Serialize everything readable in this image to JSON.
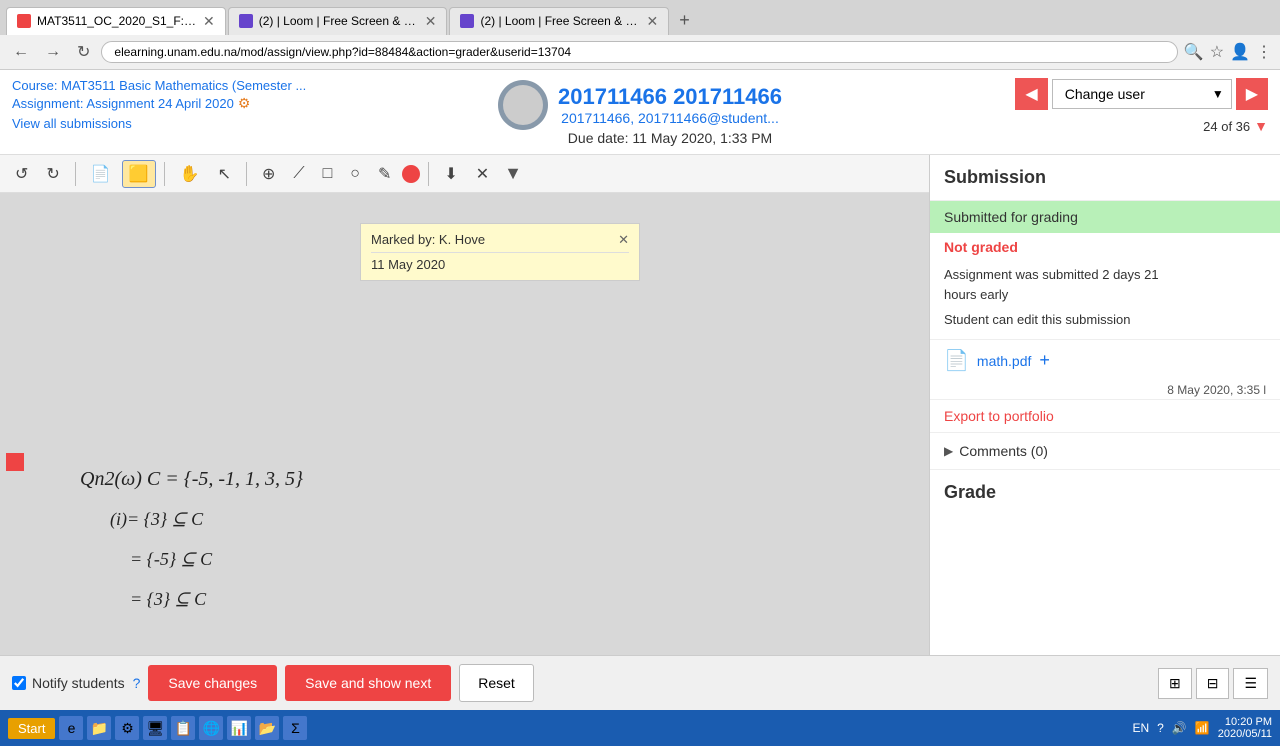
{
  "browser": {
    "tabs": [
      {
        "id": "tab1",
        "title": "MAT3511_OC_2020_S1_F: Assign...",
        "active": true,
        "favicon_color": "#e44"
      },
      {
        "id": "tab2",
        "title": "(2) | Loom | Free Screen & Video ...",
        "active": false,
        "favicon_color": "#6644cc"
      },
      {
        "id": "tab3",
        "title": "(2) | Loom | Free Screen & Video ...",
        "active": false,
        "favicon_color": "#6644cc"
      }
    ],
    "address": "elearning.unam.edu.na/mod/assign/view.php?id=88484&action=grader&userid=13704"
  },
  "top": {
    "course_link": "Course: MAT3511 Basic Mathematics (Semester ...",
    "assignment_link": "Assignment: Assignment 24 April 2020",
    "view_all": "View all submissions",
    "student_id": "201711466 201711466",
    "student_email": "201711466, 201711466@student...",
    "due_date": "Due date: 11 May 2020, 1:33 PM",
    "change_user_label": "Change user",
    "counter": "24 of 36"
  },
  "annotation": {
    "toolbar_buttons": [
      "↺",
      "↻",
      "📄",
      "🟨",
      "✋",
      "↖",
      "⊕",
      "⟋",
      "□",
      "○",
      "✎",
      "💧",
      "⬇",
      "✕"
    ]
  },
  "sticky_note": {
    "header": "Marked by: K. Hove",
    "content": "11 May 2020"
  },
  "right_panel": {
    "submission_title": "Submission",
    "status_submitted": "Submitted for grading",
    "status_not_graded": "Not graded",
    "info_line1": "Assignment was submitted 2 days 21",
    "info_line2": "hours early",
    "student_edit": "Student can edit this submission",
    "file_name": "math.pdf",
    "file_date": "8 May 2020, 3:35 l",
    "export_label": "Export to portfolio",
    "comments_label": "Comments (0)",
    "grade_title": "Grade"
  },
  "bottom": {
    "notify_label": "Notify students",
    "save_changes": "Save changes",
    "save_next": "Save and show next",
    "reset": "Reset"
  },
  "taskbar": {
    "start": "Start",
    "lang": "EN",
    "time": "10:20 PM",
    "date": "2020/05/11"
  },
  "layout_icons": [
    "⊞",
    "⊟",
    "☰"
  ]
}
